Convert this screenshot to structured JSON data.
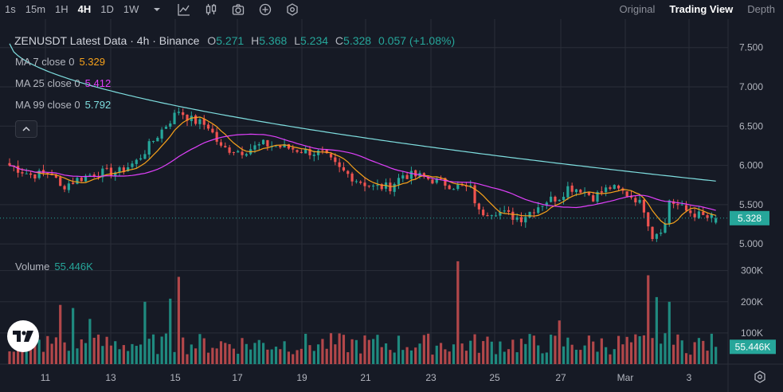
{
  "toolbar": {
    "intervals": [
      "1s",
      "15m",
      "1H",
      "4H",
      "1D",
      "1W"
    ],
    "active_interval": "4H",
    "views": [
      "Original",
      "Trading View",
      "Depth"
    ],
    "active_view": "Trading View"
  },
  "legend": {
    "title": "ZENUSDT Latest Data · 4h · Binance",
    "o_label": "O",
    "o": "5.271",
    "h_label": "H",
    "h": "5.368",
    "l_label": "L",
    "l": "5.234",
    "c_label": "C",
    "c": "5.328",
    "change": "0.057 (+1.08%)"
  },
  "ma": [
    {
      "label": "MA 7 close 0",
      "value": "5.329",
      "color": "#f7a21b"
    },
    {
      "label": "MA 25 close 0",
      "value": "5.412",
      "color": "#e040fb"
    },
    {
      "label": "MA 99 close 0",
      "value": "5.792",
      "color": "#7fdfe0"
    }
  ],
  "volume_legend": {
    "label": "Volume",
    "value": "55.446K"
  },
  "colors": {
    "up": "#26a69a",
    "down": "#ef5350",
    "up_vol": "#1f8a7f",
    "down_vol": "#b2474a",
    "bg": "#161a25",
    "grid": "#2a2e39",
    "text": "#b2b5be"
  },
  "chart_data": {
    "type": "candlestick",
    "symbol": "ZENUSDT",
    "interval": "4h",
    "exchange": "Binance",
    "price_ylim": [
      4.9,
      7.7
    ],
    "price_ticks": [
      "7.500",
      "7.000",
      "6.500",
      "6.000",
      "5.500",
      "5.000"
    ],
    "price_tick_values": [
      7.5,
      7.0,
      6.5,
      6.0,
      5.5,
      5.0
    ],
    "last_price": "5.328",
    "x_ticks": [
      "11",
      "13",
      "15",
      "17",
      "19",
      "21",
      "23",
      "25",
      "27",
      "Mar",
      "3"
    ],
    "volume_ticks": [
      "300K",
      "200K",
      "100K"
    ],
    "volume_tick_values": [
      300000,
      200000,
      100000
    ],
    "volume_ylim": [
      0,
      340000
    ],
    "last_volume": "55.446K",
    "anchors_close": [
      [
        0,
        6.0
      ],
      [
        5,
        5.88
      ],
      [
        10,
        5.9
      ],
      [
        12,
        5.72
      ],
      [
        16,
        5.82
      ],
      [
        20,
        5.9
      ],
      [
        26,
        5.92
      ],
      [
        30,
        6.05
      ],
      [
        36,
        6.45
      ],
      [
        40,
        6.7
      ],
      [
        43,
        6.58
      ],
      [
        47,
        6.5
      ],
      [
        50,
        6.22
      ],
      [
        55,
        6.18
      ],
      [
        60,
        6.27
      ],
      [
        66,
        6.22
      ],
      [
        70,
        6.18
      ],
      [
        74,
        6.15
      ],
      [
        78,
        5.95
      ],
      [
        82,
        5.82
      ],
      [
        86,
        5.72
      ],
      [
        90,
        5.73
      ],
      [
        93,
        5.88
      ],
      [
        97,
        5.86
      ],
      [
        101,
        5.8
      ],
      [
        105,
        5.74
      ],
      [
        109,
        5.7
      ],
      [
        111,
        5.4
      ],
      [
        115,
        5.42
      ],
      [
        119,
        5.35
      ],
      [
        121,
        5.33
      ],
      [
        124,
        5.45
      ],
      [
        127,
        5.55
      ],
      [
        130,
        5.6
      ],
      [
        132,
        5.72
      ],
      [
        135,
        5.7
      ],
      [
        138,
        5.6
      ],
      [
        142,
        5.72
      ],
      [
        145,
        5.66
      ],
      [
        148,
        5.58
      ],
      [
        150,
        5.45
      ],
      [
        152,
        5.1
      ],
      [
        155,
        5.25
      ],
      [
        156,
        5.56
      ],
      [
        160,
        5.42
      ],
      [
        165,
        5.33
      ],
      [
        167,
        5.328
      ]
    ],
    "n_candles": 168,
    "volume_spikes": [
      {
        "i": 40,
        "v": 280000,
        "dir": "down"
      },
      {
        "i": 38,
        "v": 210000,
        "dir": "up"
      },
      {
        "i": 32,
        "v": 200000,
        "dir": "up"
      },
      {
        "i": 15,
        "v": 180000,
        "dir": "up"
      },
      {
        "i": 12,
        "v": 190000,
        "dir": "down"
      },
      {
        "i": 106,
        "v": 330000,
        "dir": "down"
      },
      {
        "i": 151,
        "v": 285000,
        "dir": "down"
      },
      {
        "i": 153,
        "v": 215000,
        "dir": "up"
      },
      {
        "i": 156,
        "v": 200000,
        "dir": "up"
      },
      {
        "i": 130,
        "v": 140000,
        "dir": "down"
      },
      {
        "i": 19,
        "v": 145000,
        "dir": "up"
      }
    ]
  }
}
